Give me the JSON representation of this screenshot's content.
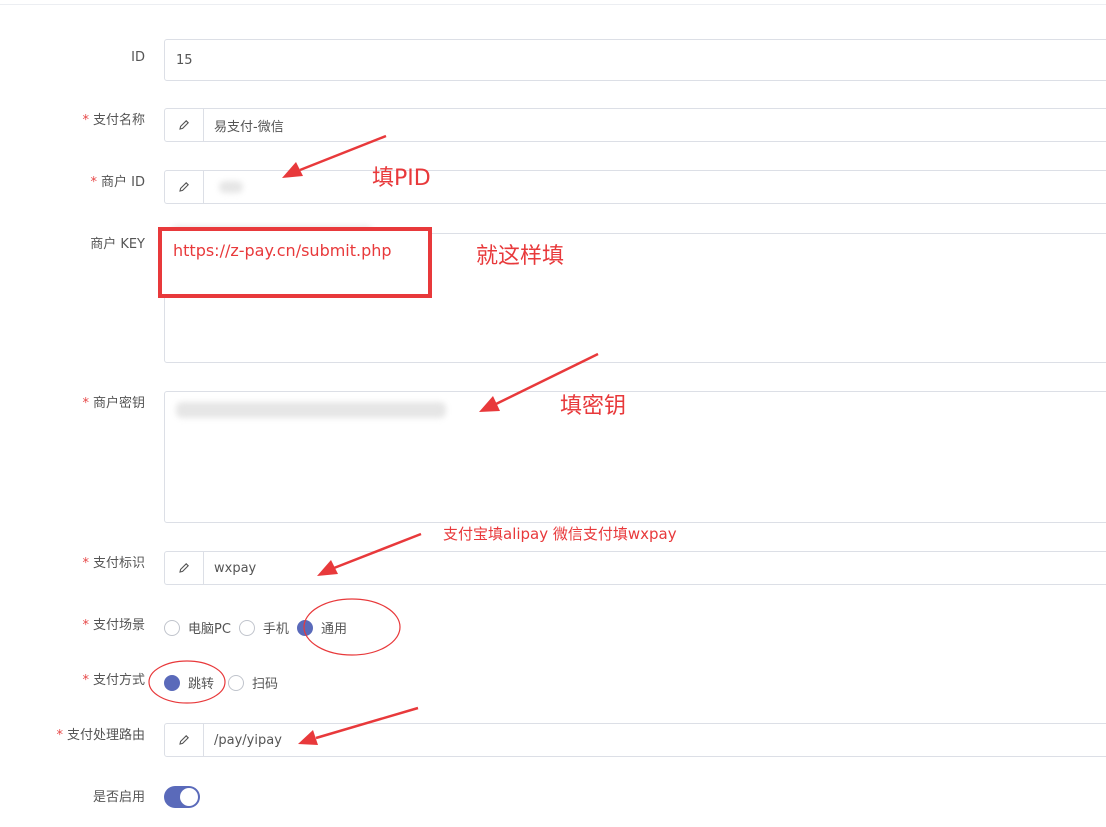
{
  "form": {
    "id": {
      "label": "ID",
      "value": "15"
    },
    "pay_name": {
      "label": "支付名称",
      "value": "易支付-微信"
    },
    "merchant_id": {
      "label": "商户 ID",
      "value": ""
    },
    "merchant_key": {
      "label": "商户 KEY",
      "value": "https://z-pay.cn/submit.php"
    },
    "merchant_secret": {
      "label": "商户密钥",
      "value": ""
    },
    "pay_flag": {
      "label": "支付标识",
      "value": "wxpay"
    },
    "pay_scene": {
      "label": "支付场景",
      "options": [
        "电脑PC",
        "手机",
        "通用"
      ],
      "selected": "通用"
    },
    "pay_method": {
      "label": "支付方式",
      "options": [
        "跳转",
        "扫码"
      ],
      "selected": "跳转"
    },
    "pay_route": {
      "label": "支付处理路由",
      "value": "/pay/yipay"
    },
    "enabled": {
      "label": "是否启用",
      "value": true
    }
  },
  "annotations": {
    "fill_pid": "填PID",
    "fill_like_this": "就这样填",
    "fill_secret": "填密钥",
    "pay_flag_hint": "支付宝填alipay 微信支付填wxpay"
  },
  "colors": {
    "accent": "#5a6aba",
    "annotation": "#e8393b",
    "required": "#e64646"
  },
  "icons": {
    "edit": "pencil-icon"
  }
}
